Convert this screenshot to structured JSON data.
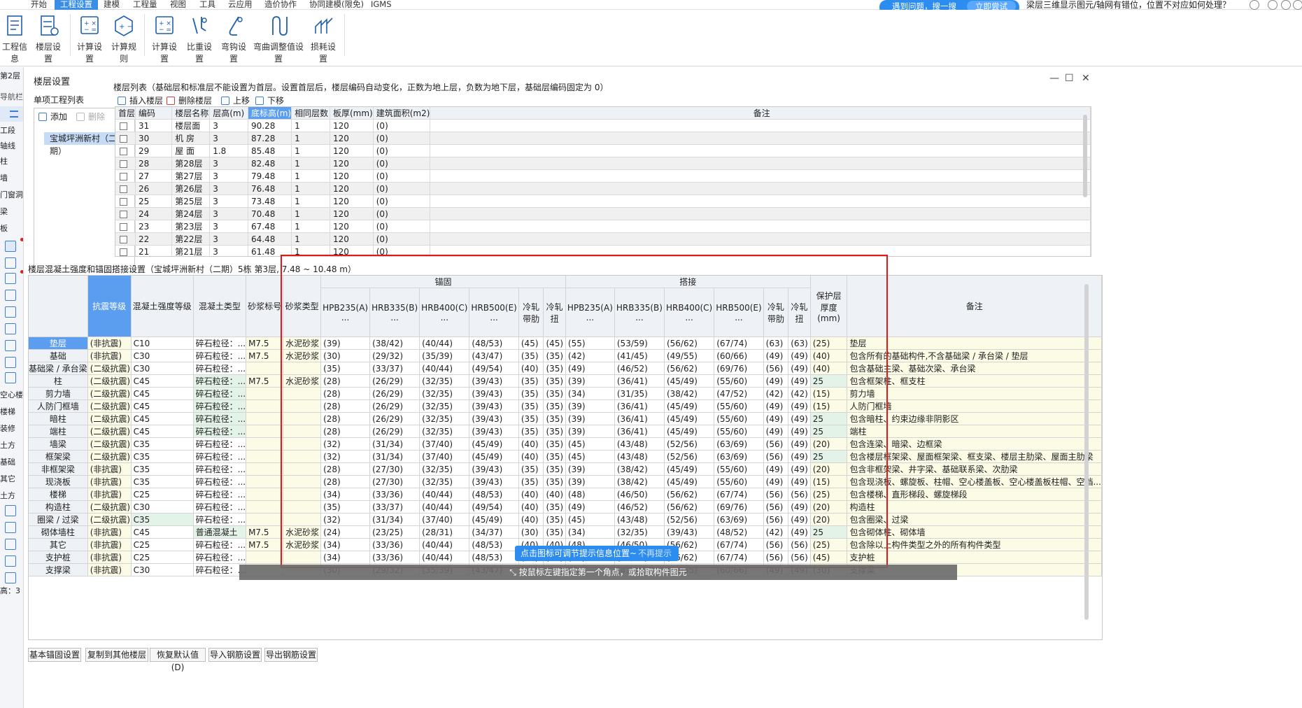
{
  "menu": {
    "items": [
      "开始",
      "工程设置",
      "建模",
      "工程量",
      "视图",
      "工具",
      "云应用",
      "造价协作",
      "协同建模(限免)",
      "IGMS"
    ],
    "active_index": 1
  },
  "promo": {
    "text": "遇到问题，搜一搜",
    "button": "立即尝试",
    "question": "梁层三维显示图元/轴网有错位，位置不对应如何处理？"
  },
  "ribbon": {
    "buttons": [
      "工程信息",
      "楼层设置",
      "计算设置",
      "计算规则",
      "计算设置",
      "比重设置",
      "弯钩设置",
      "弯曲调整值设置",
      "损耗设置"
    ]
  },
  "left_strip": {
    "items": [
      "第2层",
      "导航栏",
      "工段",
      "轴线",
      "柱",
      "墙",
      "门窗洞",
      "梁",
      "板",
      "空心楼盖",
      "楼梯",
      "装修",
      "土方",
      "基础",
      "其它",
      "土方",
      "基础",
      "其它"
    ]
  },
  "dialog": {
    "title": "楼层设置",
    "left_panel_title": "单项工程列表",
    "add": "添加",
    "delete": "删除",
    "project_item": "宝城坪洲新村（二期）",
    "floor_list_title": "楼层列表（基础层和标准层不能设置为首层。设置首层后，楼层编码自动变化，正数为地上层，负数为地下层，基础层编码固定为 0）",
    "toolbar": {
      "insert": "插入楼层",
      "delete": "删除楼层",
      "up": "上移",
      "down": "下移"
    },
    "floor_columns": [
      "首层",
      "编码",
      "楼层名称",
      "层高(m)",
      "底标高(m)",
      "相同层数",
      "板厚(mm)",
      "建筑面积(m2)",
      "备注"
    ],
    "floor_rows": [
      [
        "31",
        "楼层面",
        "3",
        "90.28",
        "1",
        "120",
        "(0)"
      ],
      [
        "30",
        "机 房",
        "3",
        "87.28",
        "1",
        "120",
        "(0)"
      ],
      [
        "29",
        "屋 面",
        "1.8",
        "85.48",
        "1",
        "120",
        "(0)"
      ],
      [
        "28",
        "第28层",
        "3",
        "82.48",
        "1",
        "120",
        "(0)"
      ],
      [
        "27",
        "第27层",
        "3",
        "79.48",
        "1",
        "120",
        "(0)"
      ],
      [
        "26",
        "第26层",
        "3",
        "76.48",
        "1",
        "120",
        "(0)"
      ],
      [
        "25",
        "第25层",
        "3",
        "73.48",
        "1",
        "120",
        "(0)"
      ],
      [
        "24",
        "第24层",
        "3",
        "70.48",
        "1",
        "120",
        "(0)"
      ],
      [
        "23",
        "第23层",
        "3",
        "67.48",
        "1",
        "120",
        "(0)"
      ],
      [
        "22",
        "第22层",
        "3",
        "64.48",
        "1",
        "120",
        "(0)"
      ],
      [
        "21",
        "第21层",
        "3",
        "61.48",
        "1",
        "120",
        "(0)"
      ]
    ],
    "concrete_title": "楼层混凝土强度和锚固搭接设置（宝城坪洲新村（二期）5栋  第3层, 7.48 ~ 10.48 m）",
    "concrete_group_anchor": "锚固",
    "concrete_group_lap": "搭接",
    "concrete_columns": [
      "抗震等级",
      "混凝土强度等级",
      "混凝土类型",
      "砂浆标号",
      "砂浆类型",
      "HPB235(A) ...",
      "HRB335(B) ...",
      "HRB400(C) ...",
      "HRB500(E) ...",
      "冷轧带肋",
      "冷轧扭",
      "HPB235(A) ...",
      "HRB335(B) ...",
      "HRB400(C) ...",
      "HRB500(E) ...",
      "冷轧带肋",
      "冷轧扭",
      "保护层厚度(mm)",
      "备注"
    ],
    "concrete_rows": [
      {
        "name": "垫层",
        "v": [
          "(非抗震)",
          "C10",
          "碎石粒径：...",
          "M7.5",
          "水泥砂浆",
          "(39)",
          "(38/42)",
          "(40/44)",
          "(48/53)",
          "(45)",
          "(45)",
          "(55)",
          "(53/59)",
          "(56/62)",
          "(67/74)",
          "(63)",
          "(63)",
          "(25)",
          "垫层"
        ]
      },
      {
        "name": "基础",
        "v": [
          "(非抗震)",
          "C30",
          "碎石粒径：...",
          "M7.5",
          "水泥砂浆",
          "(30)",
          "(29/32)",
          "(35/39)",
          "(43/47)",
          "(35)",
          "(35)",
          "(42)",
          "(41/45)",
          "(49/55)",
          "(60/66)",
          "(49)",
          "(49)",
          "(40)",
          "包含所有的基础构件,不含基础梁 / 承台梁 / 垫层"
        ]
      },
      {
        "name": "基础梁 / 承台梁",
        "v": [
          "(二级抗震)",
          "C30",
          "碎石粒径：...",
          "",
          "",
          "(35)",
          "(33/37)",
          "(40/44)",
          "(49/54)",
          "(40)",
          "(35)",
          "(49)",
          "(46/52)",
          "(56/62)",
          "(69/76)",
          "(56)",
          "(49)",
          "(40)",
          "包含基础主梁、基础次梁、承台梁"
        ]
      },
      {
        "name": "柱",
        "v": [
          "(二级抗震)",
          "C45",
          "碎石粒径：...",
          "M7.5",
          "水泥砂浆",
          "(28)",
          "(26/29)",
          "(32/35)",
          "(39/43)",
          "(35)",
          "(35)",
          "(39)",
          "(36/41)",
          "(45/49)",
          "(55/60)",
          "(49)",
          "(49)",
          "25",
          "包含框架柱、框支柱"
        ],
        "g": [
          2,
          17
        ]
      },
      {
        "name": "剪力墙",
        "v": [
          "(二级抗震)",
          "C45",
          "碎石粒径：...",
          "",
          "",
          "(28)",
          "(26/29)",
          "(32/35)",
          "(39/43)",
          "(35)",
          "(35)",
          "(34)",
          "(31/35)",
          "(38/42)",
          "(47/52)",
          "(42)",
          "(42)",
          "(15)",
          "剪力墙"
        ],
        "g": [
          2
        ]
      },
      {
        "name": "人防门框墙",
        "v": [
          "(二级抗震)",
          "C45",
          "碎石粒径：...",
          "",
          "",
          "(28)",
          "(26/29)",
          "(32/35)",
          "(39/43)",
          "(35)",
          "(35)",
          "(39)",
          "(36/41)",
          "(45/49)",
          "(55/60)",
          "(49)",
          "(49)",
          "(15)",
          "人防门框墙"
        ],
        "g": [
          2
        ]
      },
      {
        "name": "暗柱",
        "v": [
          "(二级抗震)",
          "C45",
          "碎石粒径：...",
          "",
          "",
          "(28)",
          "(26/29)",
          "(32/35)",
          "(39/43)",
          "(35)",
          "(35)",
          "(39)",
          "(36/41)",
          "(45/49)",
          "(55/60)",
          "(49)",
          "(49)",
          "25",
          "包含暗柱、约束边缘非阴影区"
        ],
        "g": [
          2,
          17
        ]
      },
      {
        "name": "端柱",
        "v": [
          "(二级抗震)",
          "C45",
          "碎石粒径：...",
          "",
          "",
          "(28)",
          "(26/29)",
          "(32/35)",
          "(39/43)",
          "(35)",
          "(35)",
          "(39)",
          "(36/41)",
          "(45/49)",
          "(55/60)",
          "(49)",
          "(49)",
          "25",
          "端柱"
        ],
        "g": [
          2,
          17
        ]
      },
      {
        "name": "墙梁",
        "v": [
          "(二级抗震)",
          "C35",
          "碎石粒径：...",
          "",
          "",
          "(32)",
          "(31/34)",
          "(37/40)",
          "(45/49)",
          "(40)",
          "(35)",
          "(45)",
          "(43/48)",
          "(52/56)",
          "(63/69)",
          "(56)",
          "(49)",
          "(20)",
          "包含连梁、暗梁、边框梁"
        ]
      },
      {
        "name": "框架梁",
        "v": [
          "(二级抗震)",
          "C35",
          "碎石粒径：...",
          "",
          "",
          "(32)",
          "(31/34)",
          "(37/40)",
          "(45/49)",
          "(40)",
          "(35)",
          "(45)",
          "(43/48)",
          "(52/56)",
          "(63/69)",
          "(56)",
          "(49)",
          "25",
          "包含楼层框架梁、屋面框架梁、框支梁、楼层主肋梁、屋面主肋梁"
        ],
        "g": [
          17
        ]
      },
      {
        "name": "非框架梁",
        "v": [
          "(非抗震)",
          "C35",
          "碎石粒径：...",
          "",
          "",
          "(28)",
          "(27/30)",
          "(32/35)",
          "(39/43)",
          "(35)",
          "(35)",
          "(39)",
          "(38/42)",
          "(45/49)",
          "(55/60)",
          "(49)",
          "(49)",
          "(20)",
          "包含非框架梁、井字梁、基础联系梁、次肋梁"
        ]
      },
      {
        "name": "现浇板",
        "v": [
          "(非抗震)",
          "C35",
          "碎石粒径：...",
          "",
          "",
          "(28)",
          "(27/30)",
          "(32/35)",
          "(39/43)",
          "(35)",
          "(35)",
          "(39)",
          "(38/42)",
          "(45/49)",
          "(55/60)",
          "(49)",
          "(49)",
          "(15)",
          "包含现浇板、螺旋板、柱帽、空心楼盖板、空心楼盖板柱帽、空档..."
        ]
      },
      {
        "name": "楼梯",
        "v": [
          "(非抗震)",
          "C25",
          "碎石粒径：...",
          "",
          "",
          "(34)",
          "(33/36)",
          "(40/44)",
          "(48/53)",
          "(40)",
          "(40)",
          "(48)",
          "(46/50)",
          "(56/62)",
          "(67/74)",
          "(56)",
          "(56)",
          "(25)",
          "包含楼梯、直形梯段、螺旋梯段"
        ]
      },
      {
        "name": "构造柱",
        "v": [
          "(二级抗震)",
          "C30",
          "碎石粒径：...",
          "",
          "",
          "(35)",
          "(33/37)",
          "(40/44)",
          "(49/54)",
          "(40)",
          "(35)",
          "(49)",
          "(46/52)",
          "(56/62)",
          "(69/76)",
          "(56)",
          "(49)",
          "(20)",
          "构造柱"
        ]
      },
      {
        "name": "圈梁 / 过梁",
        "v": [
          "(二级抗震)",
          "C35",
          "碎石粒径：...",
          "",
          "",
          "(32)",
          "(31/34)",
          "(37/40)",
          "(45/49)",
          "(40)",
          "(35)",
          "(45)",
          "(43/48)",
          "(52/56)",
          "(63/69)",
          "(56)",
          "(49)",
          "(20)",
          "包含圈梁、过梁"
        ],
        "g": [
          1
        ]
      },
      {
        "name": "砌体墙柱",
        "v": [
          "(非抗震)",
          "C45",
          "普通混凝土",
          "M7.5",
          "水泥砂浆",
          "(24)",
          "(23/25)",
          "(28/31)",
          "(34/37)",
          "(30)",
          "(35)",
          "(34)",
          "(32/35)",
          "(39/43)",
          "(48/52)",
          "(42)",
          "(49)",
          "25",
          "包含砌体柱、砌体墙"
        ],
        "g": [
          2,
          17
        ]
      },
      {
        "name": "其它",
        "v": [
          "(非抗震)",
          "C25",
          "碎石粒径：...",
          "M7.5",
          "水泥砂浆",
          "(34)",
          "(33/36)",
          "(40/44)",
          "(48/53)",
          "(40)",
          "(40)",
          "(48)",
          "(46/50)",
          "(56/62)",
          "(67/74)",
          "(56)",
          "(56)",
          "(25)",
          "包含除以上构件类型之外的所有构件类型"
        ]
      },
      {
        "name": "支护桩",
        "v": [
          "(非抗震)",
          "C25",
          "碎石粒径：...",
          "",
          "",
          "(34)",
          "(33/36)",
          "(40/44)",
          "(48/53)",
          "(40)",
          "(40)",
          "(48)",
          "(46/50)",
          "(56/62)",
          "(67/74)",
          "(56)",
          "(56)",
          "(45)",
          "支护桩"
        ]
      },
      {
        "name": "支撑梁",
        "v": [
          "(非抗震)",
          "C30",
          "碎石粒径：...",
          "",
          "",
          "(30)",
          "(29/32)",
          "(35/39)",
          "(43/47)",
          "(35)",
          "(35)",
          "(42)",
          "(41/45)",
          "(49/55)",
          "(60/66)",
          "(49)",
          "(49)",
          "(30)",
          "支撑梁"
        ]
      }
    ],
    "bottom_buttons": [
      "基本锚固设置",
      "复制到其他楼层",
      "恢复默认值(D)",
      "导入钢筋设置",
      "导出钢筋设置"
    ]
  },
  "tip": {
    "text": "点击图标可调节提示信息位置~",
    "dismiss": "不再提示"
  },
  "status": "按鼠标左键指定第一个角点，或拾取构件图元",
  "left_bottom": "高：3"
}
